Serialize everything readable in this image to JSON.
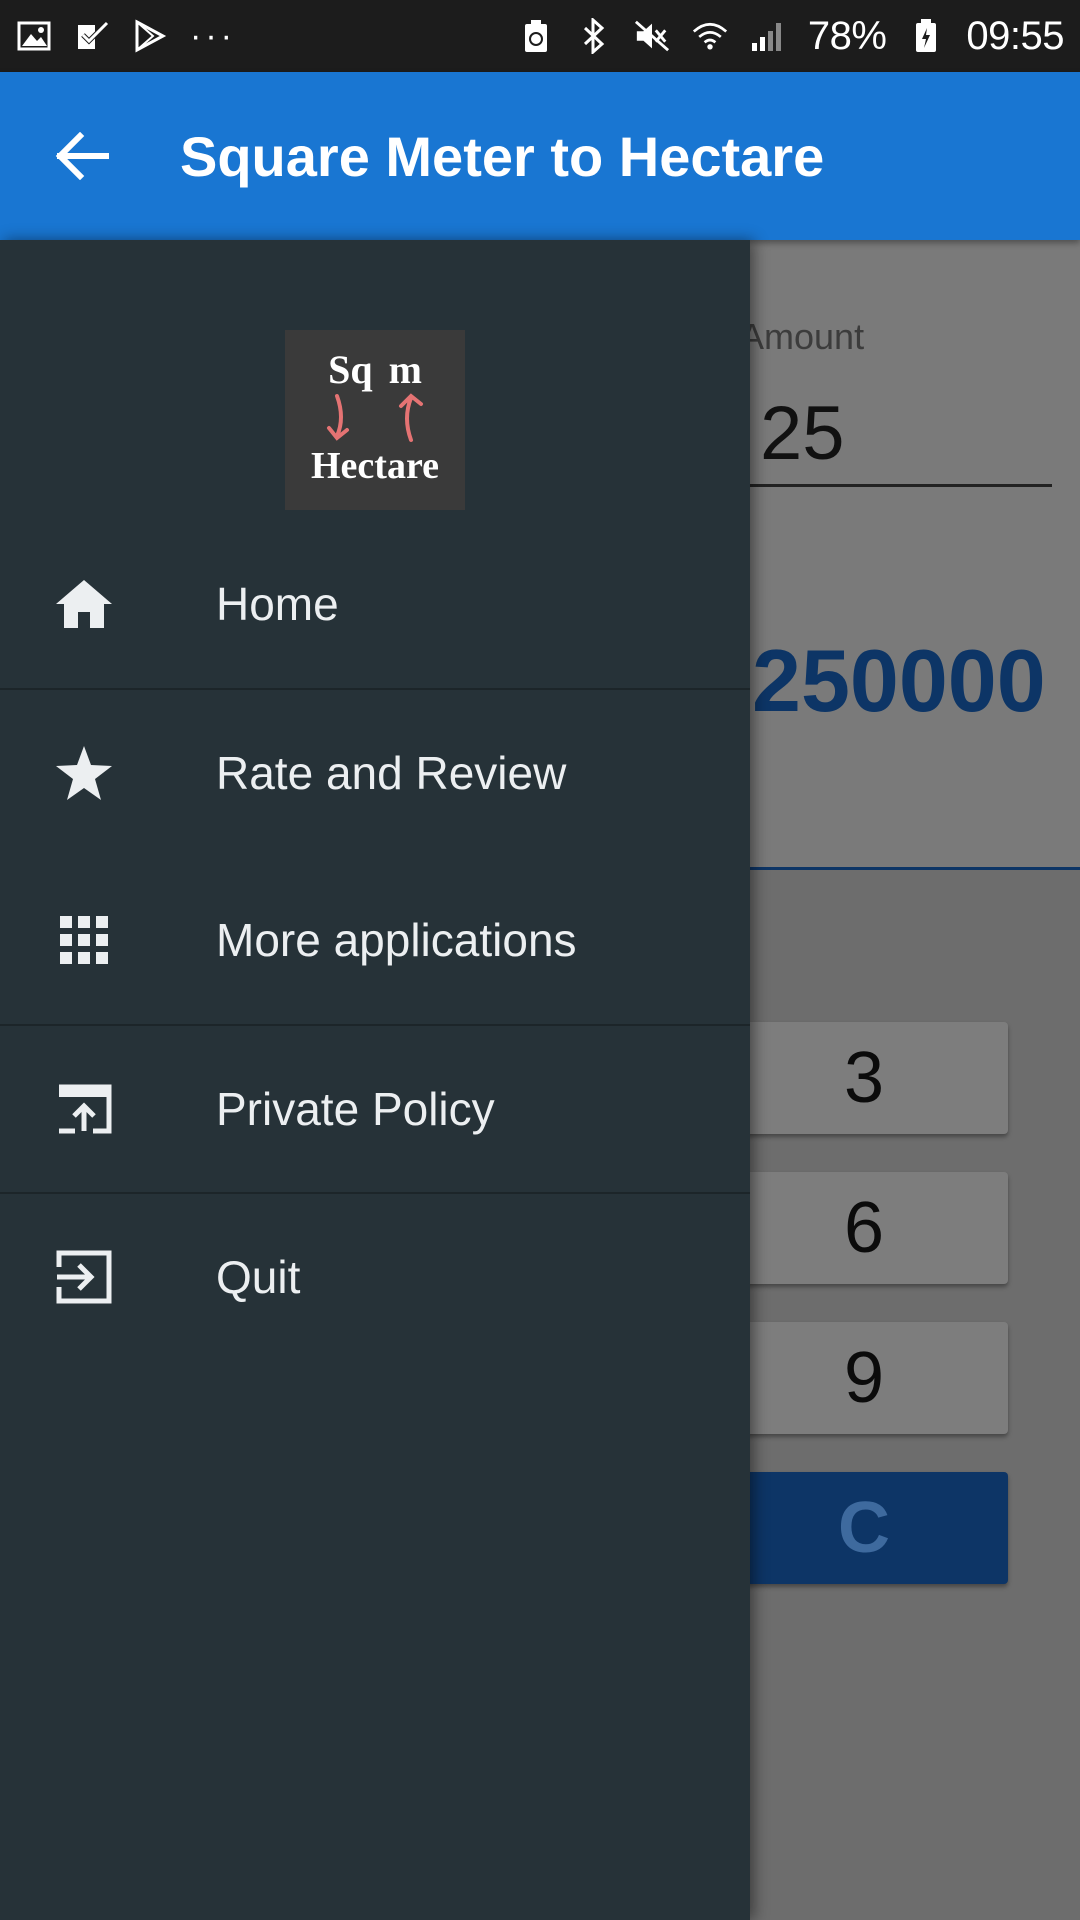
{
  "status_bar": {
    "left_icons": [
      "image-icon",
      "task-check-icon",
      "play-store-icon",
      "more-dots-icon"
    ],
    "more_dots": "···",
    "right_icons": [
      "battery-saver-icon",
      "bluetooth-icon",
      "mute-icon",
      "wifi-icon",
      "signal-icon"
    ],
    "battery_percent": "78%",
    "time": "09:55"
  },
  "app_bar": {
    "title": "Square Meter to Hectare",
    "color": "#1976d2"
  },
  "drawer": {
    "logo": {
      "top": "Sq m",
      "bottom": "Hectare"
    },
    "items": [
      {
        "label": "Home",
        "icon": "home-icon"
      },
      {
        "label": "Rate and Review",
        "icon": "star-icon"
      },
      {
        "label": "More applications",
        "icon": "apps-grid-icon"
      },
      {
        "label": "Private Policy",
        "icon": "open-external-icon"
      },
      {
        "label": "Quit",
        "icon": "exit-icon"
      }
    ],
    "background": "#263238"
  },
  "converter": {
    "amount_label": "Amount",
    "amount_value": "25",
    "result_value": "250000",
    "keys": [
      "3",
      "6",
      "9",
      "C"
    ]
  }
}
